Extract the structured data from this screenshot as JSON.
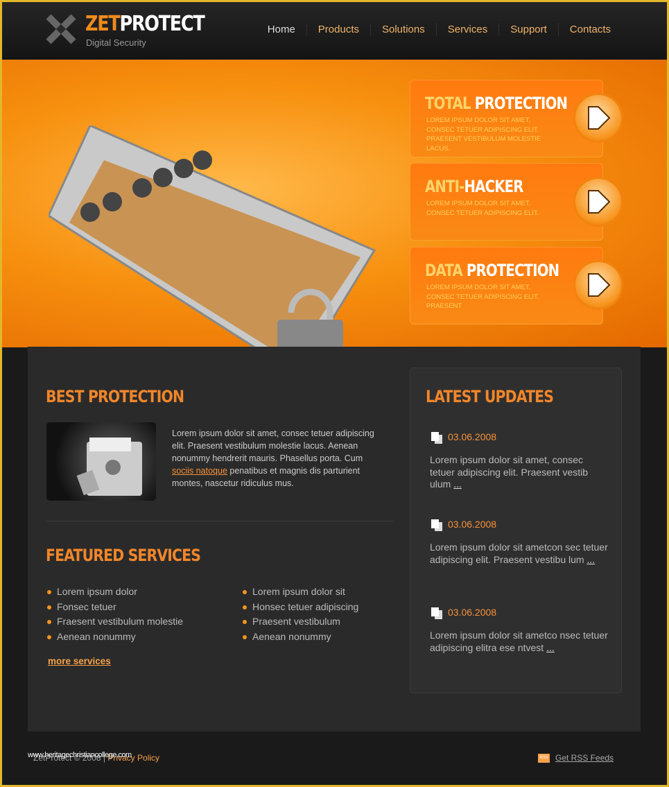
{
  "header": {
    "brand_part1": "ZET",
    "brand_part2": "PROTECT",
    "tagline": "Digital Security",
    "nav": [
      "Home",
      "Products",
      "Solutions",
      "Services",
      "Support",
      "Contacts"
    ]
  },
  "hero": {
    "cards": [
      {
        "t1": "TOTAL",
        "t2": " PROTECTION",
        "text": "Lorem ipsum dolor sit amet, consec tetuer adipiscing elit. Praesent vestibulum molestie lacus."
      },
      {
        "t1": "ANTI-",
        "t2": "HACKER",
        "text": "Lorem ipsum dolor sit amet, consec tetuer adipiscing elit."
      },
      {
        "t1": "DATA",
        "t2": " PROTECTION",
        "text": "Lorem ipsum dolor sit amet, consec tetuer adipiscing elit. Praesent"
      }
    ]
  },
  "best": {
    "title": "BEST PROTECTION",
    "text1": "Lorem ipsum dolor sit amet, consec tetuer adipiscing elit. Praesent vestibulum molestie lacus. Aenean nonummy hendrerit mauris. Phasellus porta. Cum ",
    "link": "sociis natoque",
    "text2": " penatibus et magnis dis parturient montes, nascetur ridiculus mus."
  },
  "featured": {
    "title": "FEATURED SERVICES",
    "col1": [
      "Lorem ipsum dolor",
      "Fonsec tetuer",
      "Fraesent vestibulum molestie",
      "Aenean nonummy"
    ],
    "col2": [
      "Lorem ipsum dolor sit",
      "Honsec tetuer adipiscing",
      "Praesent vestibulum",
      "Aenean nonummy"
    ],
    "more": "more services"
  },
  "updates": {
    "title": "LATEST UPDATES",
    "items": [
      {
        "date": "03.06.2008",
        "text": "Lorem ipsum dolor sit amet, consec tetuer adipiscing elit. Praesent vestib ulum ",
        "more": "..."
      },
      {
        "date": "03.06.2008",
        "text": "Lorem ipsum dolor sit ametcon sec tetuer adipiscing elit. Praesent vestibu lum ",
        "more": "..."
      },
      {
        "date": "03.06.2008",
        "text": "Lorem ipsum dolor sit ametco nsec tetuer adipiscing elitra ese ntvest ",
        "more": "..."
      }
    ]
  },
  "footer": {
    "copyright": "ZetProtect © 2008 | ",
    "privacy": "Privacy Policy",
    "rss": "Get RSS Feeds",
    "rss_badge": "RSS",
    "watermark": "www.heritagechristiancollege.com"
  },
  "colors": {
    "accent": "#f7941d",
    "border": "#e2b72c"
  }
}
